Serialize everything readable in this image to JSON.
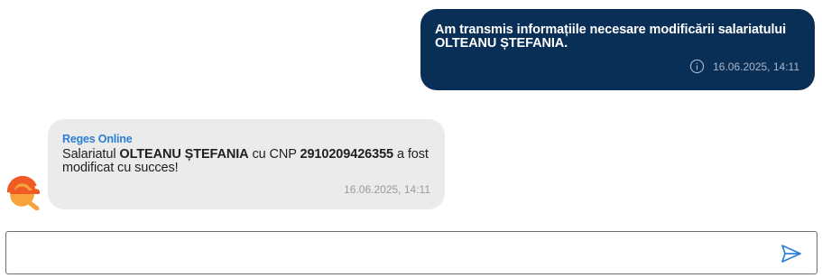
{
  "conversation": {
    "outgoing": {
      "text_line1": "Am transmis informațiile necesare modificării salariatului",
      "text_line2": "OLTEANU  ȘTEFANIA.",
      "time": "16.06.2025, 14:11",
      "status_icon": "info-icon"
    },
    "incoming": {
      "sender": "Reges Online",
      "part1": "Salariatul ",
      "employee_name": "OLTEANU  ȘTEFANIA",
      "part2": " cu CNP ",
      "cnp": "2910209426355",
      "part3": " a fost modificat cu succes!",
      "time": "16.06.2025, 14:11",
      "avatar_icon": "reges-logo-icon"
    }
  },
  "composer": {
    "placeholder": "",
    "value": "",
    "send_icon": "send-icon"
  },
  "colors": {
    "outgoing_bubble": "#0a2f57",
    "incoming_bubble": "#ebebeb",
    "sender_name": "#2a7fd4",
    "send_icon": "#2a7fd4",
    "avatar_primary": "#f05a24",
    "avatar_secondary": "#f7a23b"
  }
}
